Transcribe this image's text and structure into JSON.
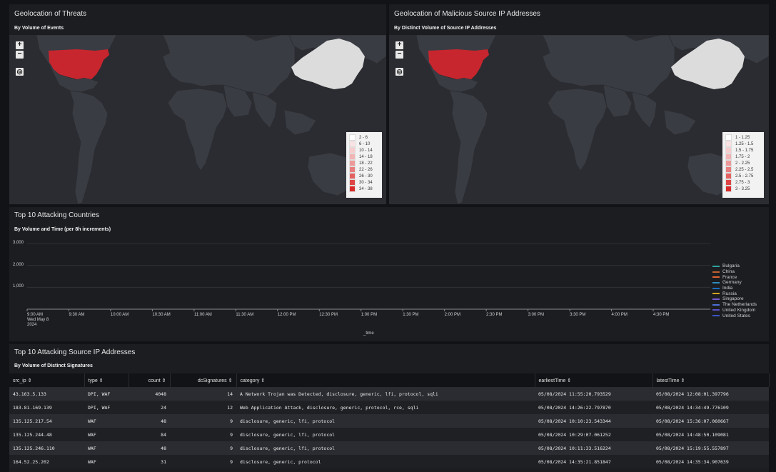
{
  "map_left": {
    "title": "Geolocation of Threats",
    "subtitle": "By Volume of Events",
    "zoom_in": "+",
    "zoom_out": "−",
    "locate": "◎",
    "legend": [
      {
        "label": "2 - 6",
        "color": "#ffffff"
      },
      {
        "label": "6 - 10",
        "color": "#fbe2e2"
      },
      {
        "label": "10 - 14",
        "color": "#f7cccc"
      },
      {
        "label": "14 - 18",
        "color": "#f2b3b3"
      },
      {
        "label": "18 - 22",
        "color": "#ed9999"
      },
      {
        "label": "22 - 26",
        "color": "#e87d7d"
      },
      {
        "label": "26 - 30",
        "color": "#e36161"
      },
      {
        "label": "30 - 34",
        "color": "#de4545"
      },
      {
        "label": "34 - 38",
        "color": "#d82a2a"
      }
    ]
  },
  "map_right": {
    "title": "Geolocation of Malicious Source IP Addresses",
    "subtitle": "By Distinct Volume of Source IP Addresses",
    "zoom_in": "+",
    "zoom_out": "−",
    "locate": "◎",
    "legend": [
      {
        "label": "1 - 1.25",
        "color": "#ffffff"
      },
      {
        "label": "1.25 - 1.5",
        "color": "#fbe2e2"
      },
      {
        "label": "1.5 - 1.75",
        "color": "#f7cccc"
      },
      {
        "label": "1.75 - 2",
        "color": "#f2b3b3"
      },
      {
        "label": "2 - 2.25",
        "color": "#ed9999"
      },
      {
        "label": "2.25 - 2.5",
        "color": "#e87d7d"
      },
      {
        "label": "2.5 - 2.75",
        "color": "#e36161"
      },
      {
        "label": "2.75 - 3",
        "color": "#de4545"
      },
      {
        "label": "3 - 3.25",
        "color": "#d82a2a"
      }
    ]
  },
  "colors": {
    "usa_fill": "#c8262e",
    "china_fill": "#dcdcdc",
    "land": "#3a3c43"
  },
  "chart_panel": {
    "title": "Top 10 Attacking Countries",
    "subtitle": "By Volume and Time (per 8h increments)"
  },
  "chart_data": {
    "type": "line",
    "xlabel": "_time",
    "ylabel": "",
    "ylim": [
      0,
      3000
    ],
    "yticks": [
      "3,000",
      "2,000",
      "1,000"
    ],
    "x_ticks": [
      "9:00 AM",
      "9:30 AM",
      "10:00 AM",
      "10:30 AM",
      "11:00 AM",
      "11:30 AM",
      "12:00 PM",
      "12:30 PM",
      "1:00 PM",
      "1:30 PM",
      "2:00 PM",
      "2:30 PM",
      "3:00 PM",
      "3:30 PM",
      "4:00 PM",
      "4:30 PM"
    ],
    "x_first_sub": [
      "Wed May 8",
      "2024"
    ],
    "grid": true,
    "legend_position": "right",
    "series": [
      {
        "name": "Bulgaria",
        "color": "#2ea39c",
        "values": []
      },
      {
        "name": "China",
        "color": "#c06030",
        "values": []
      },
      {
        "name": "France",
        "color": "#e0622e",
        "values": []
      },
      {
        "name": "Germany",
        "color": "#2d8ec0",
        "values": []
      },
      {
        "name": "India",
        "color": "#1c6bbf",
        "values": []
      },
      {
        "name": "Russia",
        "color": "#d6a41d",
        "values": []
      },
      {
        "name": "Singapore",
        "color": "#7a5bd1",
        "values": []
      },
      {
        "name": "The Netherlands",
        "color": "#4d6fd8",
        "values": []
      },
      {
        "name": "United Kingdom",
        "color": "#5a4fc6",
        "values": []
      },
      {
        "name": "United States",
        "color": "#3a56c8",
        "values": []
      }
    ]
  },
  "table_panel": {
    "title": "Top 10 Attacking Source IP Addresses",
    "subtitle": "By Volume of Distinct Signatures"
  },
  "table": {
    "columns": [
      "src_ip ⇕",
      "type ⇕",
      "count ⇕",
      "dcSignatures ⇕",
      "category ⇕",
      "earliestTime ⇕",
      "latestTime ⇕"
    ],
    "rows": [
      [
        "43.163.5.133",
        "DPI, WAF",
        "4048",
        "14",
        "A Network Trojan was Detected, disclosure, generic, lfi, protocol, sqli",
        "05/08/2024 11:55:20.793529",
        "05/08/2024 12:08:01.397796"
      ],
      [
        "183.81.169.139",
        "DPI, WAF",
        "24",
        "12",
        "Web Application Attack, disclosure, generic, protocol, rce, sqli",
        "05/08/2024 14:26:22.797870",
        "05/08/2024 14:34:49.776109"
      ],
      [
        "135.125.217.54",
        "WAF",
        "48",
        "9",
        "disclosure, generic, lfi, protocol",
        "05/08/2024 10:10:23.543344",
        "05/08/2024 15:36:07.060667"
      ],
      [
        "135.125.244.48",
        "WAF",
        "84",
        "9",
        "disclosure, generic, lfi, protocol",
        "05/08/2024 10:29:07.061252",
        "05/08/2024 14:48:50.109081"
      ],
      [
        "135.125.246.110",
        "WAF",
        "48",
        "9",
        "disclosure, generic, lfi, protocol",
        "05/08/2024 10:11:33.516224",
        "05/08/2024 15:19:55.557897"
      ],
      [
        "164.52.25.202",
        "WAF",
        "31",
        "9",
        "disclosure, generic, protocol",
        "05/08/2024 14:35:21.851847",
        "05/08/2024 14:35:34.907639"
      ]
    ]
  }
}
